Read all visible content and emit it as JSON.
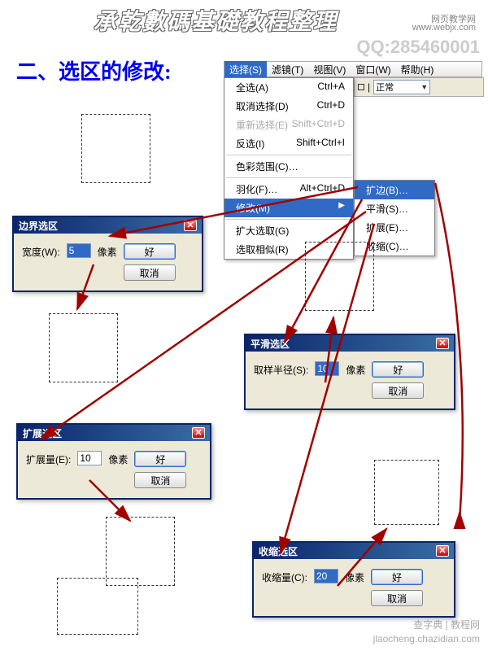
{
  "watermark": {
    "top": "承乾數碼基礎教程整理",
    "site": "网页教学网",
    "site2": "www.webjx.com",
    "qq": "QQ:285460001",
    "br": "jlaocheng.chazidian.com",
    "br2": "查字典 | 教程网"
  },
  "heading": "二、选区的修改:",
  "menubar": {
    "select": "选择(S)",
    "filter": "滤镜(T)",
    "view": "视图(V)",
    "window": "窗口(W)",
    "help": "帮助(H)"
  },
  "toolbar": {
    "select_value": "正常"
  },
  "dropdown": {
    "all": "全选(A)",
    "all_sc": "Ctrl+A",
    "deselect": "取消选择(D)",
    "deselect_sc": "Ctrl+D",
    "reselect": "重新选择(E)",
    "reselect_sc": "Shift+Ctrl+D",
    "inverse": "反选(I)",
    "inverse_sc": "Shift+Ctrl+I",
    "colorrange": "色彩范围(C)…",
    "feather": "羽化(F)…",
    "feather_sc": "Alt+Ctrl+D",
    "modify": "修改(M)",
    "grow": "扩大选取(G)",
    "similar": "选取相似(R)"
  },
  "submenu": {
    "border": "扩边(B)…",
    "smooth": "平滑(S)…",
    "expand": "扩展(E)…",
    "contract": "收缩(C)…"
  },
  "dlg_border": {
    "title": "边界选区",
    "label": "宽度(W):",
    "value": "5",
    "unit": "像素",
    "ok": "好",
    "cancel": "取消"
  },
  "dlg_smooth": {
    "title": "平滑选区",
    "label": "取样半径(S):",
    "value": "10",
    "unit": "像素",
    "ok": "好",
    "cancel": "取消"
  },
  "dlg_expand": {
    "title": "扩展选区",
    "label": "扩展量(E):",
    "value": "10",
    "unit": "像素",
    "ok": "好",
    "cancel": "取消"
  },
  "dlg_contract": {
    "title": "收缩选区",
    "label": "收缩量(C):",
    "value": "20",
    "unit": "像素",
    "ok": "好",
    "cancel": "取消"
  }
}
